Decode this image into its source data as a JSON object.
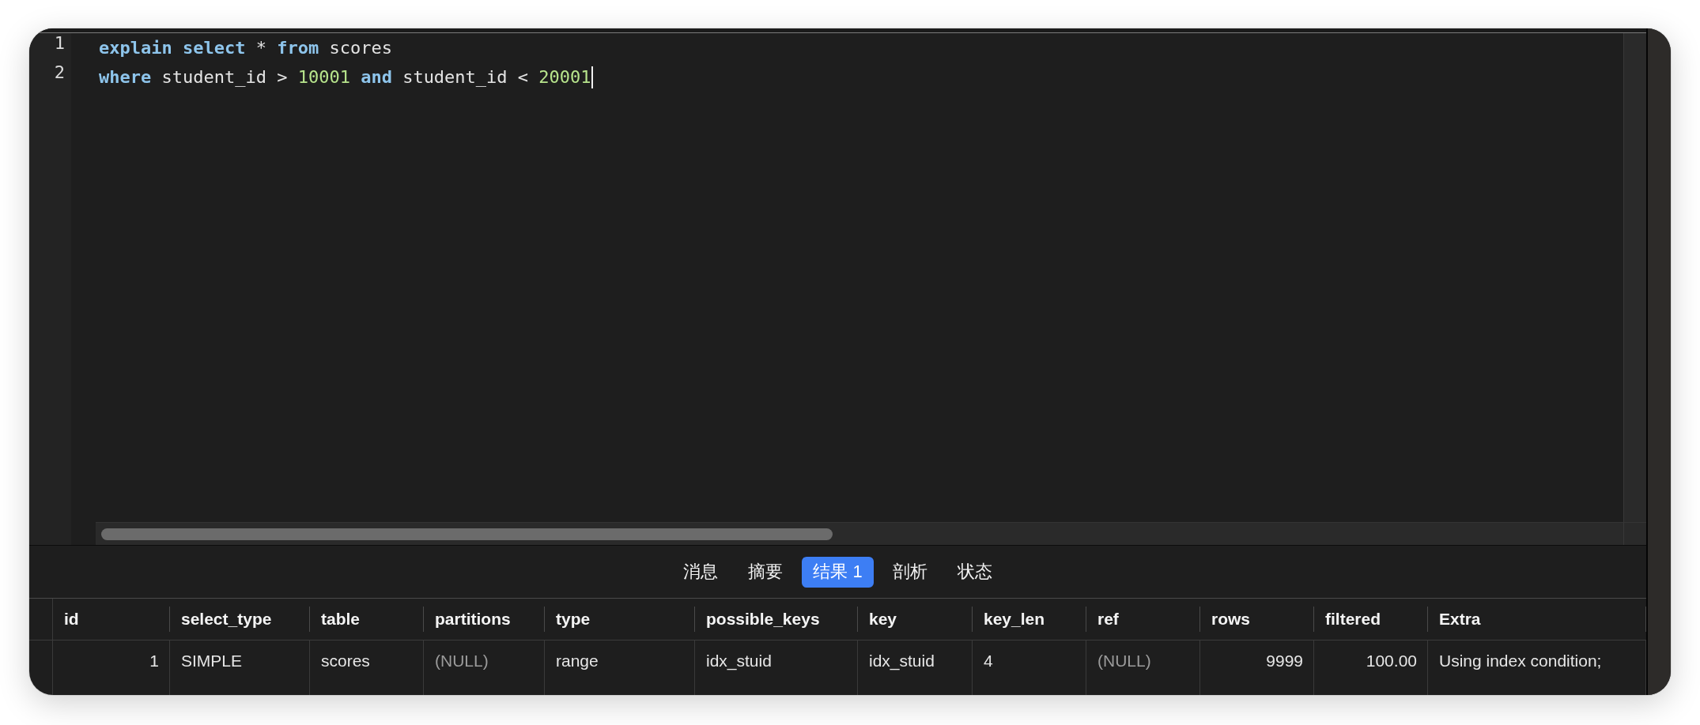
{
  "editor": {
    "lines": [
      {
        "number": "1",
        "caret": false,
        "tokens": [
          {
            "kind": "keyword",
            "text": "explain"
          },
          {
            "kind": "keyword",
            "text": " select"
          },
          {
            "kind": "plain",
            "text": " * "
          },
          {
            "kind": "keyword",
            "text": "from"
          },
          {
            "kind": "plain",
            "text": " scores"
          }
        ]
      },
      {
        "number": "2",
        "caret": true,
        "tokens": [
          {
            "kind": "keyword",
            "text": "where"
          },
          {
            "kind": "plain",
            "text": " student_id > "
          },
          {
            "kind": "number",
            "text": "10001"
          },
          {
            "kind": "keyword",
            "text": " and"
          },
          {
            "kind": "plain",
            "text": " student_id < "
          },
          {
            "kind": "number",
            "text": "20001"
          }
        ]
      }
    ]
  },
  "result_tabs": [
    {
      "label": "消息",
      "selected": false
    },
    {
      "label": "摘要",
      "selected": false
    },
    {
      "label": "结果 1",
      "selected": true
    },
    {
      "label": "剖析",
      "selected": false
    },
    {
      "label": "状态",
      "selected": false
    }
  ],
  "table": {
    "columns": [
      "id",
      "select_type",
      "table",
      "partitions",
      "type",
      "possible_keys",
      "key",
      "key_len",
      "ref",
      "rows",
      "filtered",
      "Extra"
    ],
    "rows": [
      {
        "cells": [
          {
            "kind": "number",
            "text": "1"
          },
          {
            "kind": "text",
            "text": "SIMPLE"
          },
          {
            "kind": "text",
            "text": "scores"
          },
          {
            "kind": "null",
            "text": "(NULL)"
          },
          {
            "kind": "text",
            "text": "range"
          },
          {
            "kind": "text",
            "text": "idx_stuid"
          },
          {
            "kind": "text",
            "text": "idx_stuid"
          },
          {
            "kind": "text",
            "text": "4"
          },
          {
            "kind": "null",
            "text": "(NULL)"
          },
          {
            "kind": "number",
            "text": "9999"
          },
          {
            "kind": "number",
            "text": "100.00"
          },
          {
            "kind": "text",
            "text": "Using index condition;"
          }
        ]
      }
    ]
  }
}
